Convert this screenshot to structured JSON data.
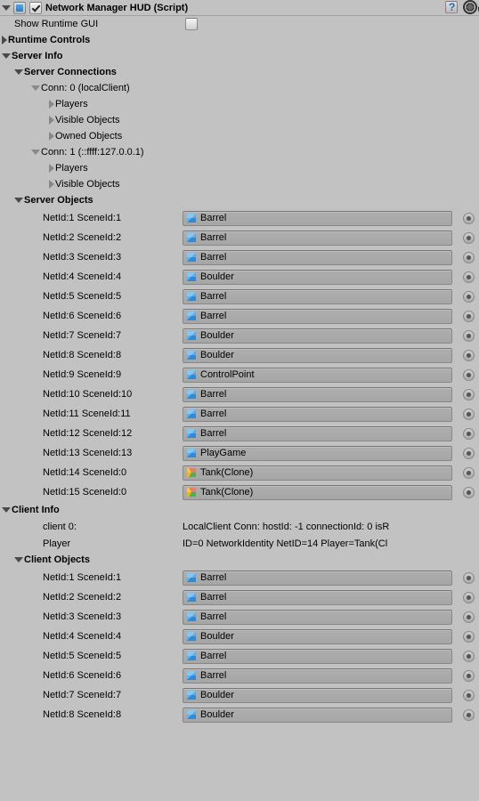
{
  "header": {
    "title": "Network Manager HUD (Script)"
  },
  "showRuntime": {
    "label": "Show Runtime GUI"
  },
  "runtimeControls": {
    "label": "Runtime Controls"
  },
  "serverInfo": {
    "label": "Server Info",
    "connections": {
      "label": "Server Connections",
      "items": [
        {
          "label": "Conn: 0 (localClient)",
          "children": [
            "Players",
            "Visible Objects",
            "Owned Objects"
          ]
        },
        {
          "label": "Conn: 1 (::ffff:127.0.0.1)",
          "children": [
            "Players",
            "Visible Objects"
          ]
        }
      ]
    },
    "objects": {
      "label": "Server Objects",
      "rows": [
        {
          "id": "NetId:1 SceneId:1",
          "name": "Barrel",
          "ico": "blue"
        },
        {
          "id": "NetId:2 SceneId:2",
          "name": "Barrel",
          "ico": "blue"
        },
        {
          "id": "NetId:3 SceneId:3",
          "name": "Barrel",
          "ico": "blue"
        },
        {
          "id": "NetId:4 SceneId:4",
          "name": "Boulder",
          "ico": "blue"
        },
        {
          "id": "NetId:5 SceneId:5",
          "name": "Barrel",
          "ico": "blue"
        },
        {
          "id": "NetId:6 SceneId:6",
          "name": "Barrel",
          "ico": "blue"
        },
        {
          "id": "NetId:7 SceneId:7",
          "name": "Boulder",
          "ico": "blue"
        },
        {
          "id": "NetId:8 SceneId:8",
          "name": "Boulder",
          "ico": "blue"
        },
        {
          "id": "NetId:9 SceneId:9",
          "name": "ControlPoint",
          "ico": "blue"
        },
        {
          "id": "NetId:10 SceneId:10",
          "name": "Barrel",
          "ico": "blue"
        },
        {
          "id": "NetId:11 SceneId:11",
          "name": "Barrel",
          "ico": "blue"
        },
        {
          "id": "NetId:12 SceneId:12",
          "name": "Barrel",
          "ico": "blue"
        },
        {
          "id": "NetId:13 SceneId:13",
          "name": "PlayGame",
          "ico": "blue"
        },
        {
          "id": "NetId:14 SceneId:0",
          "name": "Tank(Clone)",
          "ico": "multi"
        },
        {
          "id": "NetId:15 SceneId:0",
          "name": "Tank(Clone)",
          "ico": "multi"
        }
      ]
    }
  },
  "clientInfo": {
    "label": "Client Info",
    "client0": {
      "label": "client 0:",
      "value": "LocalClient Conn: hostId: -1 connectionId: 0 isR"
    },
    "player": {
      "label": "Player",
      "value": "ID=0 NetworkIdentity NetID=14 Player=Tank(Cl"
    },
    "objects": {
      "label": "Client Objects",
      "rows": [
        {
          "id": "NetId:1 SceneId:1",
          "name": "Barrel",
          "ico": "blue"
        },
        {
          "id": "NetId:2 SceneId:2",
          "name": "Barrel",
          "ico": "blue"
        },
        {
          "id": "NetId:3 SceneId:3",
          "name": "Barrel",
          "ico": "blue"
        },
        {
          "id": "NetId:4 SceneId:4",
          "name": "Boulder",
          "ico": "blue"
        },
        {
          "id": "NetId:5 SceneId:5",
          "name": "Barrel",
          "ico": "blue"
        },
        {
          "id": "NetId:6 SceneId:6",
          "name": "Barrel",
          "ico": "blue"
        },
        {
          "id": "NetId:7 SceneId:7",
          "name": "Boulder",
          "ico": "blue"
        },
        {
          "id": "NetId:8 SceneId:8",
          "name": "Boulder",
          "ico": "blue"
        }
      ]
    }
  }
}
